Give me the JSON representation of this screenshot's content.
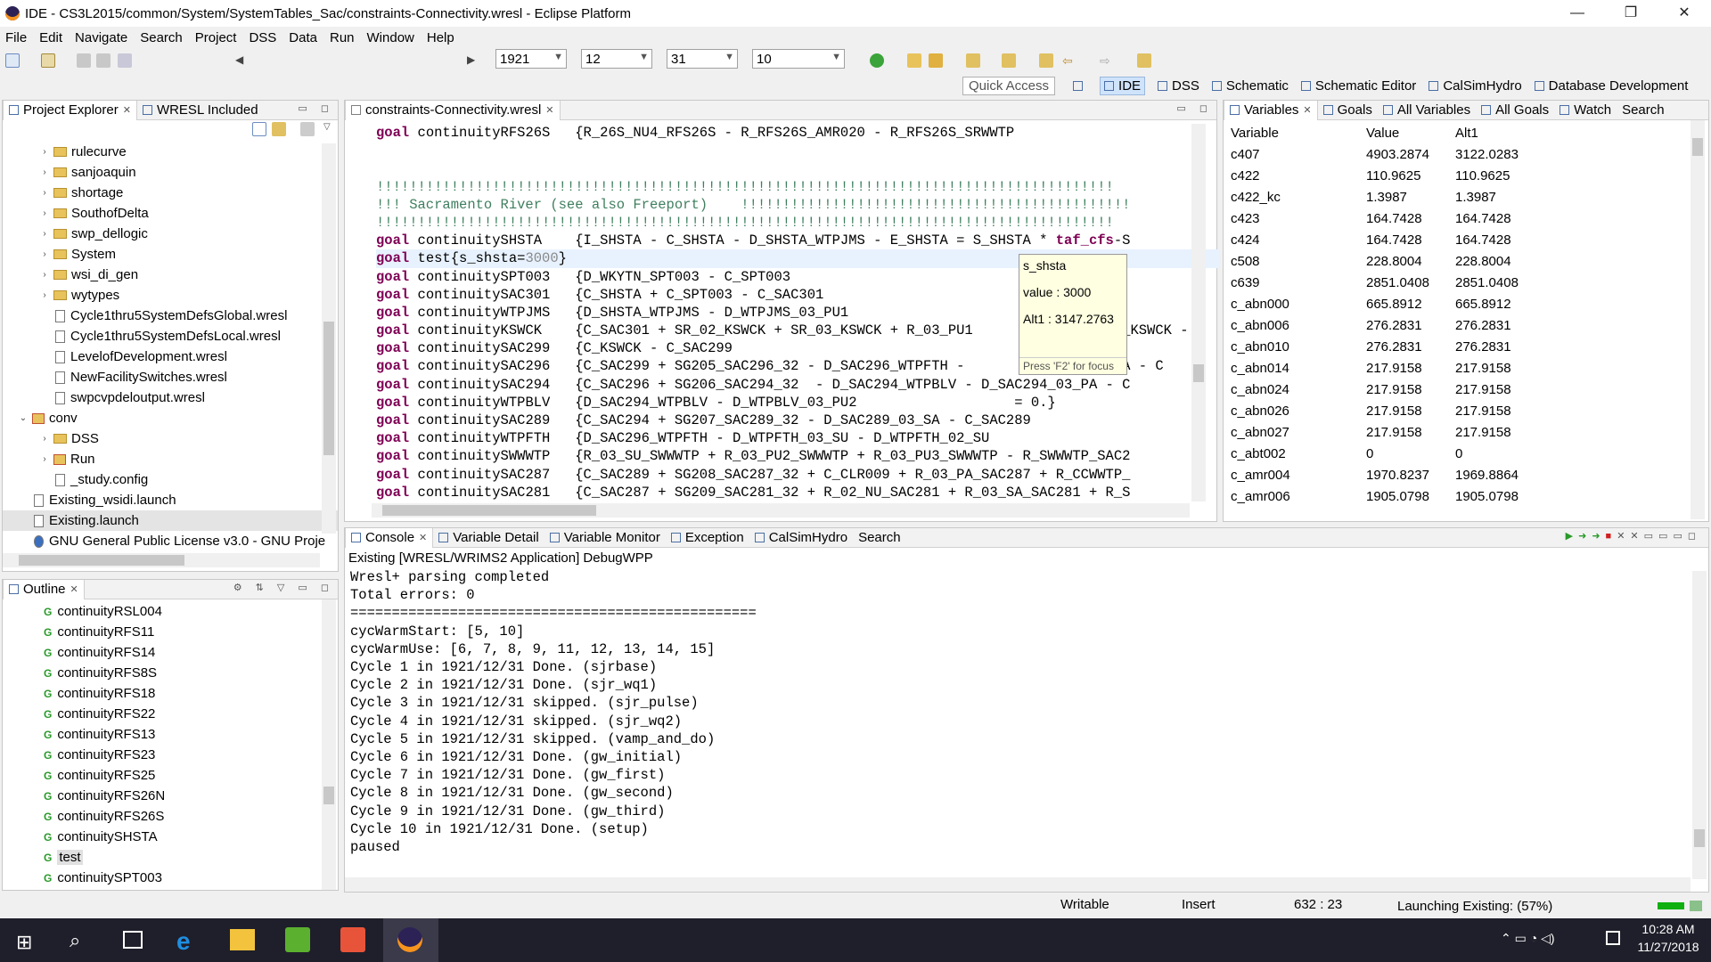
{
  "window": {
    "title": "IDE - CS3L2015/common/System/SystemTables_Sac/constraints-Connectivity.wresl - Eclipse Platform",
    "minimize": "—",
    "maximize": "❐",
    "close": "✕"
  },
  "menu": [
    "File",
    "Edit",
    "Navigate",
    "Search",
    "Project",
    "DSS",
    "Data",
    "Run",
    "Window",
    "Help"
  ],
  "toolbar": {
    "year": "1921",
    "month": "12",
    "day": "31",
    "cycle": "10"
  },
  "perspectives": {
    "quick_access": "Quick Access",
    "items": [
      "IDE",
      "DSS",
      "Schematic",
      "Schematic Editor",
      "CalSimHydro",
      "Database Development"
    ]
  },
  "project_explorer": {
    "tabs": [
      "Project Explorer",
      "WRESL Included"
    ],
    "items": [
      {
        "label": "rulecurve",
        "type": "folder",
        "indent": 2
      },
      {
        "label": "sanjoaquin",
        "type": "folder",
        "indent": 2
      },
      {
        "label": "shortage",
        "type": "folder",
        "indent": 2
      },
      {
        "label": "SouthofDelta",
        "type": "folder",
        "indent": 2
      },
      {
        "label": "swp_dellogic",
        "type": "folder",
        "indent": 2
      },
      {
        "label": "System",
        "type": "folder",
        "indent": 2
      },
      {
        "label": "wsi_di_gen",
        "type": "folder",
        "indent": 2
      },
      {
        "label": "wytypes",
        "type": "folder",
        "indent": 2
      },
      {
        "label": "Cycle1thru5SystemDefsGlobal.wresl",
        "type": "file",
        "indent": 2
      },
      {
        "label": "Cycle1thru5SystemDefsLocal.wresl",
        "type": "file",
        "indent": 2
      },
      {
        "label": "LevelofDevelopment.wresl",
        "type": "file",
        "indent": 2
      },
      {
        "label": "NewFacilitySwitches.wresl",
        "type": "file",
        "indent": 2
      },
      {
        "label": "swpcvpdeloutput.wresl",
        "type": "file",
        "indent": 2
      },
      {
        "label": "conv",
        "type": "proj",
        "indent": 1
      },
      {
        "label": "DSS",
        "type": "folder",
        "indent": 2
      },
      {
        "label": "Run",
        "type": "proj",
        "indent": 2
      },
      {
        "label": "_study.config",
        "type": "file",
        "indent": 2
      },
      {
        "label": "Existing_wsidi.launch",
        "type": "file",
        "indent": 1
      },
      {
        "label": "Existing.launch",
        "type": "file",
        "indent": 1
      },
      {
        "label": "GNU General Public License v3.0 - GNU Proje",
        "type": "globe",
        "indent": 1
      }
    ]
  },
  "outline": {
    "tab": "Outline",
    "items": [
      "continuityRSL004",
      "continuityRFS11",
      "continuityRFS14",
      "continuityRFS8S",
      "continuityRFS18",
      "continuityRFS22",
      "continuityRFS13",
      "continuityRFS23",
      "continuityRFS25",
      "continuityRFS26N",
      "continuityRFS26S",
      "continuitySHSTA",
      "test",
      "continuitySPT003"
    ]
  },
  "editor": {
    "tab": "constraints-Connectivity.wresl",
    "lines": [
      {
        "kw": "goal",
        "rest": " continuityRFS26S   {R_26S_NU4_RFS26S - R_RFS26S_AMR020 - R_RFS26S_SRWWTP"
      },
      {
        "kw": "",
        "rest": ""
      },
      {
        "kw": "",
        "rest": ""
      },
      {
        "cm": "!!!!!!!!!!!!!!!!!!!!!!!!!!!!!!!!!!!!!!!!!!!!!!!!!!!!!!!!!!!!!!!!!!!!!!!!!!!!!!!!!!!!!!!!!"
      },
      {
        "cm": "!!! Sacramento River (see also Freeport)    !!!!!!!!!!!!!!!!!!!!!!!!!!!!!!!!!!!!!!!!!!!!!!!"
      },
      {
        "cm": "!!!!!!!!!!!!!!!!!!!!!!!!!!!!!!!!!!!!!!!!!!!!!!!!!!!!!!!!!!!!!!!!!!!!!!!!!!!!!!!!!!!!!!!!!"
      },
      {
        "kw": "goal",
        "rest": " continuitySHSTA    {I_SHSTA - C_SHSTA - D_SHSTA_WTPJMS - E_SHSTA = S_SHSTA * ",
        "bold": "taf_cfs",
        "tail": "-S"
      },
      {
        "kw": "goal",
        "rest": " test{s_shsta=",
        "num": "3000",
        "tail": "}",
        "current": true
      },
      {
        "kw": "goal",
        "rest": " continuitySPT003   {D_WKYTN_SPT003 - C_SPT003"
      },
      {
        "kw": "goal",
        "rest": " continuitySAC301   {C_SHSTA + C_SPT003 - C_SAC301"
      },
      {
        "kw": "goal",
        "rest": " continuityWTPJMS   {D_SHSTA_WTPJMS - D_WTPJMS_03_PU1"
      },
      {
        "kw": "goal",
        "rest": " continuityKSWCK    {C_SAC301 + SR_02_KSWCK + SR_03_KSWCK + R_03_PU1                  _KSWCK -"
      },
      {
        "kw": "goal",
        "rest": " continuitySAC299   {C_KSWCK - C_SAC299"
      },
      {
        "kw": "goal",
        "rest": " continuitySAC296   {C_SAC299 + SG205_SAC296_32 - D_SAC296_WTPFTH -                 _SA - C"
      },
      {
        "kw": "goal",
        "rest": " continuitySAC294   {C_SAC296 + SG206_SAC294_32  - D_SAC294_WTPBLV - D_SAC294_03_PA - C"
      },
      {
        "kw": "goal",
        "rest": " continuityWTPBLV   {D_SAC294_WTPBLV - D_WTPBLV_03_PU2                   = 0.}"
      },
      {
        "kw": "goal",
        "rest": " continuitySAC289   {C_SAC294 + SG207_SAC289_32 - D_SAC289_03_SA - C_SAC289"
      },
      {
        "kw": "goal",
        "rest": " continuityWTPFTH   {D_SAC296_WTPFTH - D_WTPFTH_03_SU - D_WTPFTH_02_SU"
      },
      {
        "kw": "goal",
        "rest": " continuitySWWWTP   {R_03_SU_SWWWTP + R_03_PU2_SWWWTP + R_03_PU3_SWWWTP - R_SWWWTP_SAC2"
      },
      {
        "kw": "goal",
        "rest": " continuitySAC287   {C_SAC289 + SG208_SAC287_32 + C_CLR009 + R_03_PA_SAC287 + R_CCWWTP_"
      },
      {
        "kw": "goal",
        "rest": " continuitySAC281   {C_SAC287 + SG209_SAC281_32 + R_02_NU_SAC281 + R_03_SA_SAC281 + R_S"
      }
    ],
    "tooltip": {
      "name": "s_shsta",
      "value": "value : 3000",
      "alt": "Alt1   : 3147.2763",
      "hint": "Press 'F2' for focus"
    }
  },
  "variables": {
    "tabs": [
      "Variables",
      "Goals",
      "All Variables",
      "All Goals",
      "Watch",
      "Search"
    ],
    "headers": [
      "Variable",
      "Value",
      "Alt1"
    ],
    "rows": [
      [
        "c407",
        "4903.2874",
        "3122.0283"
      ],
      [
        "c422",
        "110.9625",
        "110.9625"
      ],
      [
        "c422_kc",
        "1.3987",
        "1.3987"
      ],
      [
        "c423",
        "164.7428",
        "164.7428"
      ],
      [
        "c424",
        "164.7428",
        "164.7428"
      ],
      [
        "c508",
        "228.8004",
        "228.8004"
      ],
      [
        "c639",
        "2851.0408",
        "2851.0408"
      ],
      [
        "c_abn000",
        "665.8912",
        "665.8912"
      ],
      [
        "c_abn006",
        "276.2831",
        "276.2831"
      ],
      [
        "c_abn010",
        "276.2831",
        "276.2831"
      ],
      [
        "c_abn014",
        "217.9158",
        "217.9158"
      ],
      [
        "c_abn024",
        "217.9158",
        "217.9158"
      ],
      [
        "c_abn026",
        "217.9158",
        "217.9158"
      ],
      [
        "c_abn027",
        "217.9158",
        "217.9158"
      ],
      [
        "c_abt002",
        "0",
        "0"
      ],
      [
        "c_amr004",
        "1970.8237",
        "1969.8864"
      ],
      [
        "c_amr006",
        "1905.0798",
        "1905.0798"
      ]
    ]
  },
  "console": {
    "tabs": [
      "Console",
      "Variable Detail",
      "Variable Monitor",
      "Exception",
      "CalSimHydro",
      "Search"
    ],
    "header": "Existing [WRESL/WRIMS2 Application] DebugWPP",
    "lines": [
      "Wresl+ parsing completed",
      "Total errors: 0",
      "=================================================",
      "cycWarmStart: [5, 10]",
      "cycWarmUse: [6, 7, 8, 9, 11, 12, 13, 14, 15]",
      "Cycle 1 in 1921/12/31 Done. (sjrbase)",
      "Cycle 2 in 1921/12/31 Done. (sjr_wq1)",
      "Cycle 3 in 1921/12/31 skipped. (sjr_pulse)",
      "Cycle 4 in 1921/12/31 skipped. (sjr_wq2)",
      "Cycle 5 in 1921/12/31 skipped. (vamp_and_do)",
      "Cycle 6 in 1921/12/31 Done. (gw_initial)",
      "Cycle 7 in 1921/12/31 Done. (gw_first)",
      "Cycle 8 in 1921/12/31 Done. (gw_second)",
      "Cycle 9 in 1921/12/31 Done. (gw_third)",
      "Cycle 10 in 1921/12/31 Done. (setup)",
      "paused"
    ]
  },
  "status": {
    "writable": "Writable",
    "insert": "Insert",
    "position": "632 : 23",
    "progress": "Launching Existing: (57%)"
  },
  "taskbar": {
    "time": "10:28 AM",
    "date": "11/27/2018"
  },
  "colors": {
    "keyword": "#7f0055",
    "comment": "#3f7f5f",
    "taskbar": "#1f1f2b"
  }
}
